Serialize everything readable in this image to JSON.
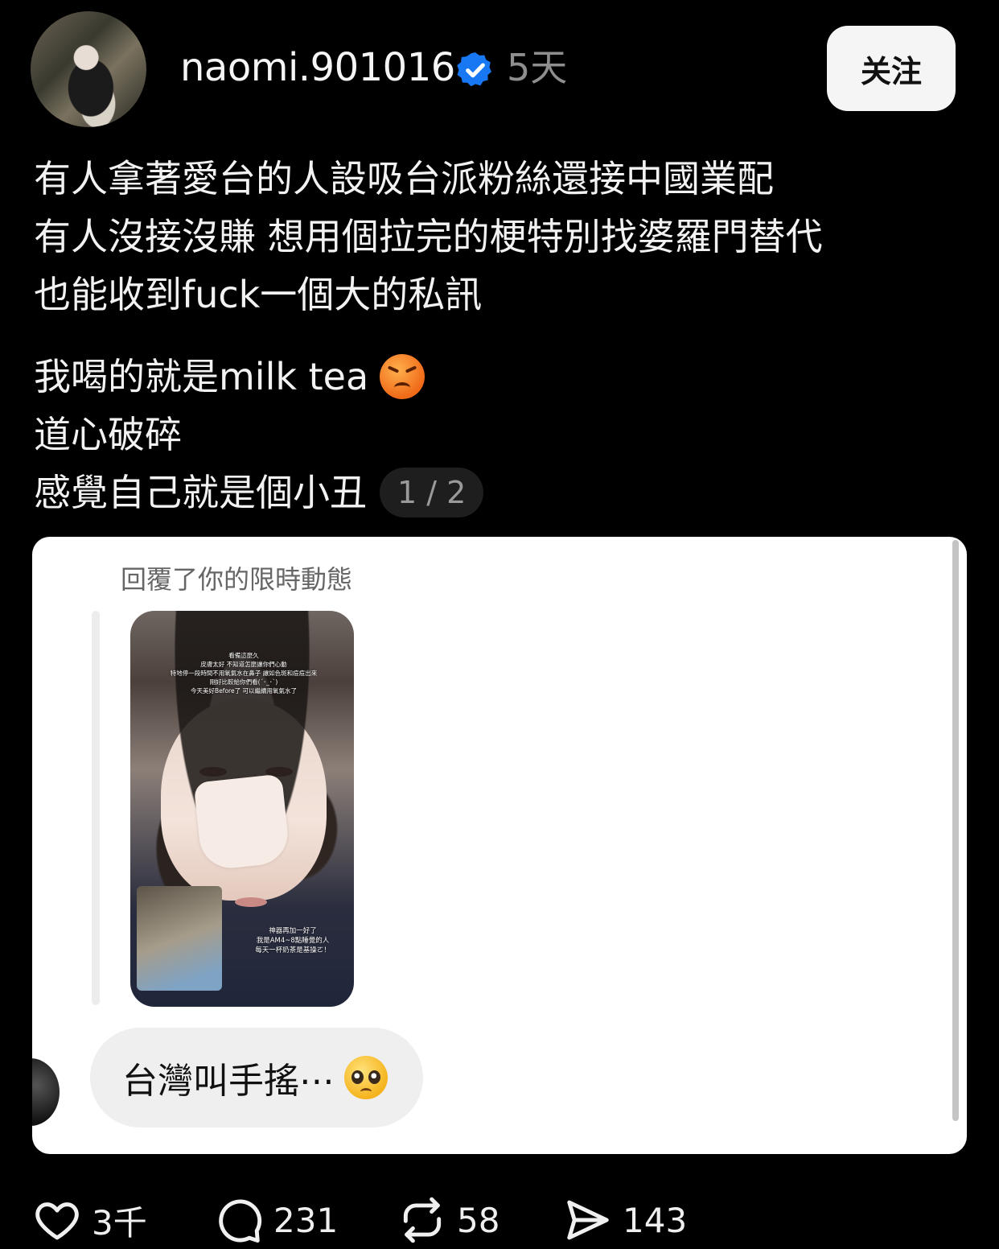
{
  "post": {
    "username": "naomi.901016",
    "time": "5天",
    "follow_label": "关注",
    "lines": [
      "有人拿著愛台的人設吸台派粉絲還接中國業配",
      "有人沒接沒賺 想用個拉完的梗特別找婆羅門替代",
      "也能收到fuck一個大的私訊"
    ],
    "lines2": [
      "我喝的就是milk tea",
      "道心破碎",
      "感覺自己就是個小丑"
    ],
    "page_counter": "1 / 2"
  },
  "attachment": {
    "reply_label": "回覆了你的限時動態",
    "story_caption_top": [
      "看備這麼久",
      "皮膚太好 不知道怎麼讓你們心動",
      "特地停一段時間不用氧氣水在鼻子 讓如色斑和痘痘出來",
      "剛好比較給你們看(´･_･`)",
      "今天美好Before了 可以繼續用氧氣水了"
    ],
    "story_caption_bottom": [
      "神器再加一好了",
      "我是AM4~8點睡覺的人",
      "每天一杯奶茶是基操ㄛ！"
    ],
    "message": "台灣叫手搖⋯"
  },
  "actions": {
    "likes": "3千",
    "comments": "231",
    "reposts": "58",
    "shares": "143"
  },
  "colors": {
    "background": "#000000",
    "verified": "#1877f2",
    "muted": "#8e8e8e"
  }
}
